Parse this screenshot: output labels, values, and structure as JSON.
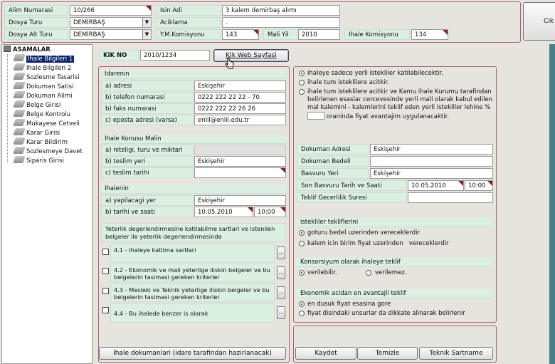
{
  "top": {
    "alim_no_label": "Alim Numarasi",
    "alim_no_value": "10/266",
    "isin_adi_label": "Isin Adi",
    "isin_adi_value": "3 kalem demirbaş alımı",
    "dosya_turu_label": "Dosya Turu",
    "dosya_turu_value": "DEMİRBAŞ",
    "aciklama_label": "Aciklama",
    "aciklama_value": ".",
    "dosya_alt_turu_label": "Dosya Alt Turu",
    "dosya_alt_turu_value": "DEMİRBAŞ",
    "ym_komisyonu_label": "Y.M.Komisyonu",
    "ym_komisyonu_value": "143",
    "mali_yil_label": "Mali Yil",
    "mali_yil_value": "2010",
    "ihale_komisyonu_label": "Ihale Komisyonu",
    "ihale_komisyonu_value": "134",
    "exit_label": "Cik"
  },
  "tree": {
    "root_label": "ASAMALAR",
    "items": [
      "Ihale Bilgileri 1",
      "Ihale Bilgileri 2",
      "Sozlesme Tasarisi",
      "Dokuman Satisi",
      "Dokuman Alimi",
      "Belge Girisi",
      "Belge Kontrolu",
      "Mukayese Cetveli",
      "Karar Girisi",
      "Karar Bildirim",
      "Sozlesmeye Davet",
      "Siparis Girisi"
    ]
  },
  "kik": {
    "label": "KiK NO",
    "value": "2010/1234",
    "web_button": "Kik Web Sayfasi"
  },
  "idarenin": {
    "title": "Idarenin",
    "adres_label": "a) adresi",
    "adres_value": "Eskişehir",
    "telefon_label": "b) telefon numarasi",
    "telefon_value": "0222 222 22 22 - 70",
    "faks_label": "b) faks numarasi",
    "faks_value": "0222 222 22 26 26",
    "eposta_label": "c) eposta adresi (varsa)",
    "eposta_value": "enlil@enlil.edu.tr"
  },
  "konu": {
    "title": "Ihale Konusu Malin",
    "nitelik_label": "a) niteligi, turu ve miktari",
    "teslim_yeri_label": "b) teslim yeri",
    "teslim_yeri_value": "Eskişehir",
    "teslim_tarihi_label": "c) teslim tarihi",
    "teslim_tarihi_value": ""
  },
  "ihalenin": {
    "title": "Ihalenin",
    "yer_label": "a) yapilacagi yer",
    "yer_value": "Eskişehir",
    "tarih_label": "b) tarihi ve saati",
    "tarih_value": "10.05.2010",
    "saat_value": "10:00"
  },
  "yeterlik": {
    "header": "Yeterlik degerlendirmesine katilabilme sartlari ve istenilen belgeler ile yeterlik degerlendirmesinde",
    "items": [
      "4.1 - Ihaleye katilma sartlari",
      "4.2 - Ekonomik ve mali yeterlige iliskin belgeler ve bu belgelerin tasimasi gereken kriterler",
      "4.3 - Mesleki ve Teknik yeterlige iliskin belgeler ve bu belgelerin tasimasi gereken kriterler",
      "4.4 - Bu ihalede benzer is olarak"
    ],
    "dots": "..."
  },
  "dokuman_button": "Ihale dokumanlari (idare tarafindan hazirlanacak)",
  "katilim": {
    "opt1": "ihaleye sadece yerli istekliler katilabilecektir.",
    "opt2": "ihale tum isteklilere acitkir.",
    "opt3": "ihale tum isteklilere acitkir ve Kamu ihale Kurumu tarafindan belirlenen esaslar cercevesinde yerli mali olarak kabul edilen mal kalemini - kalemlerini teklif eden yerli istekliler lehine %",
    "opt3_tail": "oraninda fiyat avantajim uygulanacaktir."
  },
  "dokuman": {
    "adres_label": "Dokuman Adresi",
    "adres_value": "Eskişehir",
    "bedel_label": "Dokuman Bedeli",
    "bedel_value": "",
    "basvuru_label": "Basvuru Yeri",
    "basvuru_value": "Eskişehir",
    "son_basvuru_label": "Son Basvuru Tarih ve Saati",
    "son_basvuru_tarih": "10.05.2010",
    "son_basvuru_saat": "10:00",
    "teklif_label": "Teklif Gecerlilik Suresi",
    "teklif_value": ""
  },
  "teklif_sekli": {
    "title": "istekliler tekliflerini",
    "opt1": "goturu bedel uzerinden vereceklerdir",
    "opt2": "kalem icin birim fiyat uzerinden   vereceklerdir"
  },
  "konsorsiyum": {
    "title": "Konsorsiyum olarak ihaleye teklif",
    "opt1": "verilebilir.",
    "opt2": "verilemez."
  },
  "avantajli": {
    "title": "Ekonomik acidan en avantajli teklif",
    "opt1": "en dusuk fiyat esasina gore",
    "opt2": "fiyat disindaki unsurlar da dikkate alinarak belirlenir"
  },
  "actions": {
    "kaydet": "Kaydet",
    "temizle": "Temizle",
    "teknik": "Teknik Sartname"
  }
}
